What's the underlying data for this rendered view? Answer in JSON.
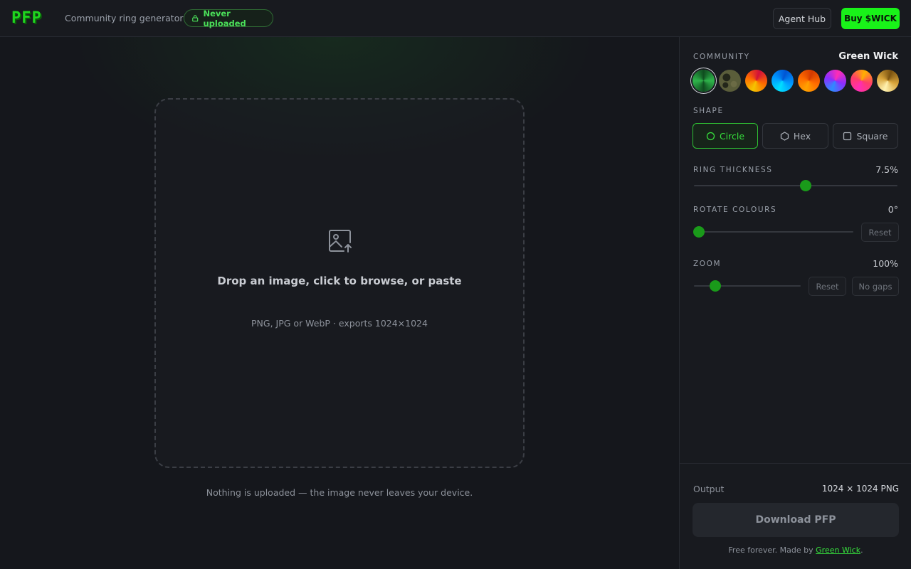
{
  "header": {
    "logo": "PFP",
    "tagline": "Community ring generator",
    "badge": "Never uploaded",
    "agent_hub": "Agent Hub",
    "buy": "Buy $WICK"
  },
  "dropzone": {
    "title": "Drop an image, click to browse, or paste",
    "subtitle": "PNG, JPG or WebP · exports 1024×1024",
    "footnote": "Nothing is uploaded — the image never leaves your device."
  },
  "panel": {
    "community": {
      "label": "COMMUNITY",
      "selected": "Green Wick",
      "swatches": [
        {
          "name": "green",
          "colors": [
            "#0f4d1f",
            "#2fb54b",
            "#0f4d1f"
          ]
        },
        {
          "name": "olive",
          "colors": [
            "#2f3320",
            "#5a5d3a",
            "#23261a"
          ]
        },
        {
          "name": "sunset",
          "colors": [
            "#f5c400",
            "#ff6a00",
            "#d10f3a"
          ]
        },
        {
          "name": "cyan",
          "colors": [
            "#00e0ff",
            "#0099ff",
            "#0055d4"
          ]
        },
        {
          "name": "orange",
          "colors": [
            "#ffa200",
            "#ff6a00",
            "#d43a00"
          ]
        },
        {
          "name": "violet",
          "colors": [
            "#2d8cff",
            "#8b2dff",
            "#ff2db4"
          ]
        },
        {
          "name": "magenta",
          "colors": [
            "#ff2db4",
            "#ff3d6a",
            "#ffb000"
          ]
        },
        {
          "name": "gold",
          "colors": [
            "#fff2b0",
            "#d8a43a",
            "#7a5210"
          ]
        }
      ]
    },
    "shape": {
      "label": "SHAPE",
      "options": [
        "Circle",
        "Hex",
        "Square"
      ],
      "selected": "Circle"
    },
    "ring_thickness": {
      "label": "RING THICKNESS",
      "display": "7.5%",
      "fraction": 0.55
    },
    "rotate_colours": {
      "label": "ROTATE COLOURS",
      "display": "0°",
      "fraction": 0.03,
      "reset": "Reset"
    },
    "zoom": {
      "label": "ZOOM",
      "display": "100%",
      "fraction": 0.2,
      "reset": "Reset",
      "no_gaps": "No gaps"
    },
    "output": {
      "label": "Output",
      "value": "1024 × 1024 PNG",
      "download": "Download PFP",
      "credits_prefix": "Free forever. Made by ",
      "credits_link": "Green Wick",
      "credits_suffix": "."
    }
  }
}
